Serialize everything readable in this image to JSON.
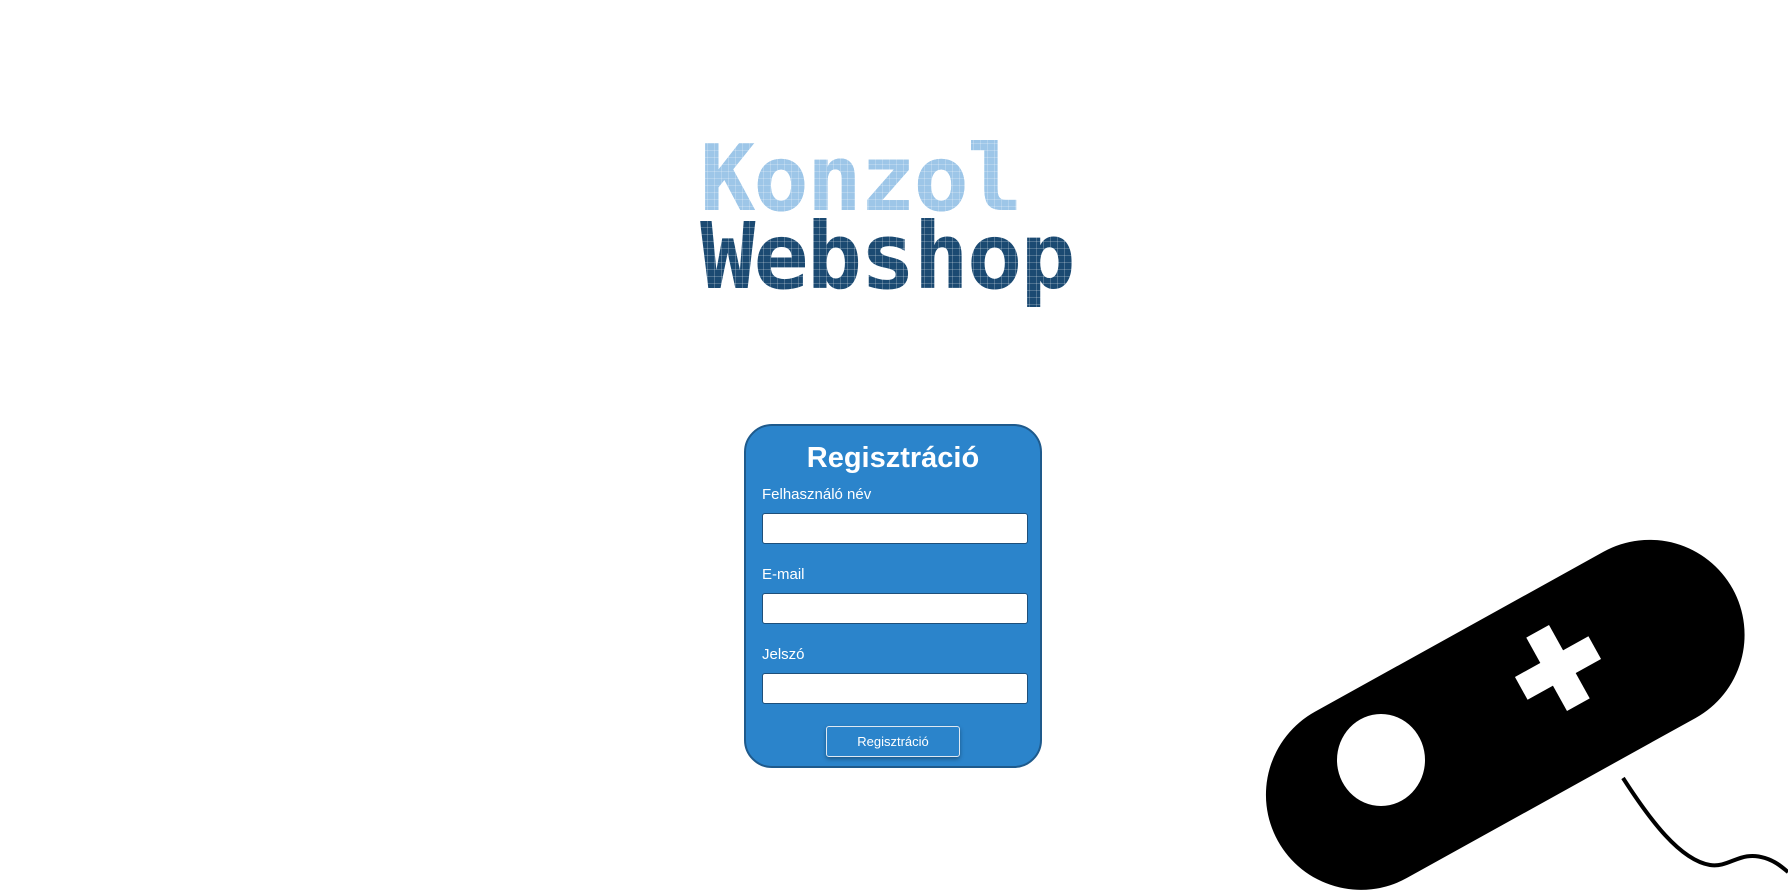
{
  "logo": {
    "line1": "Konzol",
    "line2": "Webshop",
    "colors": {
      "line1": "#9dc6e8",
      "line2": "#1b4a72"
    }
  },
  "form": {
    "title": "Regisztráció",
    "fields": [
      {
        "label": "Felhasználó név",
        "value": "",
        "placeholder": ""
      },
      {
        "label": "E-mail",
        "value": "",
        "placeholder": ""
      },
      {
        "label": "Jelszó",
        "value": "",
        "placeholder": ""
      }
    ],
    "submit_label": "Regisztráció",
    "colors": {
      "card_background": "#2b84cb",
      "card_border": "#1e5a8c"
    }
  },
  "decoration": {
    "icon": "gamepad-icon",
    "color": "#000000"
  }
}
